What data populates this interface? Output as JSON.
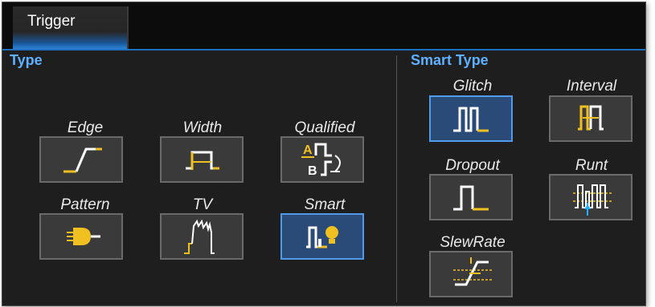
{
  "tab": {
    "label": "Trigger"
  },
  "type_section": {
    "header": "Type",
    "buttons": [
      {
        "label": "Edge",
        "icon": "edge-trigger-icon"
      },
      {
        "label": "Width",
        "icon": "width-trigger-icon"
      },
      {
        "label": "Qualified",
        "icon": "qualified-trigger-icon"
      },
      {
        "label": "Pattern",
        "icon": "pattern-trigger-icon"
      },
      {
        "label": "TV",
        "icon": "tv-trigger-icon"
      },
      {
        "label": "Smart",
        "icon": "smart-trigger-icon",
        "selected": true
      }
    ]
  },
  "smart_section": {
    "header": "Smart Type",
    "buttons": [
      {
        "label": "Glitch",
        "icon": "glitch-icon",
        "selected": true
      },
      {
        "label": "Interval",
        "icon": "interval-icon"
      },
      {
        "label": "Dropout",
        "icon": "dropout-icon"
      },
      {
        "label": "Runt",
        "icon": "runt-icon"
      },
      {
        "label": "SlewRate",
        "icon": "slewrate-icon"
      }
    ]
  },
  "colors": {
    "accent_blue": "#5fb0ff",
    "waveform_white": "#ffffff",
    "waveform_yellow": "#f0c020",
    "selected_border": "#4f9bea"
  }
}
